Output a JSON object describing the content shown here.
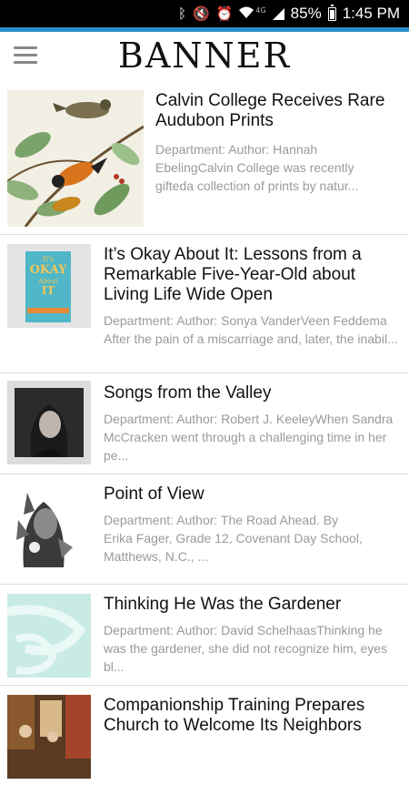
{
  "status_bar": {
    "icons": [
      "bluetooth-icon",
      "mute-icon",
      "alarm-icon",
      "wifi-icon",
      "lte-icon",
      "signal-icon",
      "battery-icon"
    ],
    "network_label": "4G",
    "battery_pct": "85%",
    "time": "1:45 PM"
  },
  "header": {
    "logo": "BANNER",
    "accent_color": "#2a8ec9",
    "menu_icon": "hamburger-icon"
  },
  "articles": [
    {
      "title": "Calvin College Receives Rare Audubon Prints",
      "snippet": "Department: Author: Hannah EbelingCalvin College was recently gifteda collection of prints by natur...",
      "image": "audubon-birds-print"
    },
    {
      "title": "It’s Okay About It: Lessons from a Remarkable Five-Year-Old about Living Life Wide Open",
      "snippet": "Department: Author: Sonya VanderVeen Feddema After the pain of a miscarriage and, later, the inabil...",
      "image": "book-cover",
      "image_text": [
        "It's",
        "OKAY",
        "About",
        "IT"
      ]
    },
    {
      "title": "Songs from the Valley",
      "snippet": "Department: Author: Robert J. KeeleyWhen Sandra McCracken went through a challenging time in her pe...",
      "image": "album-cover-portrait"
    },
    {
      "title": "Point of View",
      "snippet": "Department: Author: The Road Ahead. By Erika Fager, Grade 12, Covenant Day School, Matthews, N.C., ...",
      "image": "double-exposure-portrait"
    },
    {
      "title": "Thinking He Was the Gardener",
      "snippet": "Department: Author: David SchelhaasThinking he was the gardener, she did not recognize him, eyes bl...",
      "image": "teal-abstract"
    },
    {
      "title": "Companionship Training Prepares Church to Welcome Its Neighbors",
      "snippet": "",
      "image": "church-interior-photo"
    }
  ]
}
